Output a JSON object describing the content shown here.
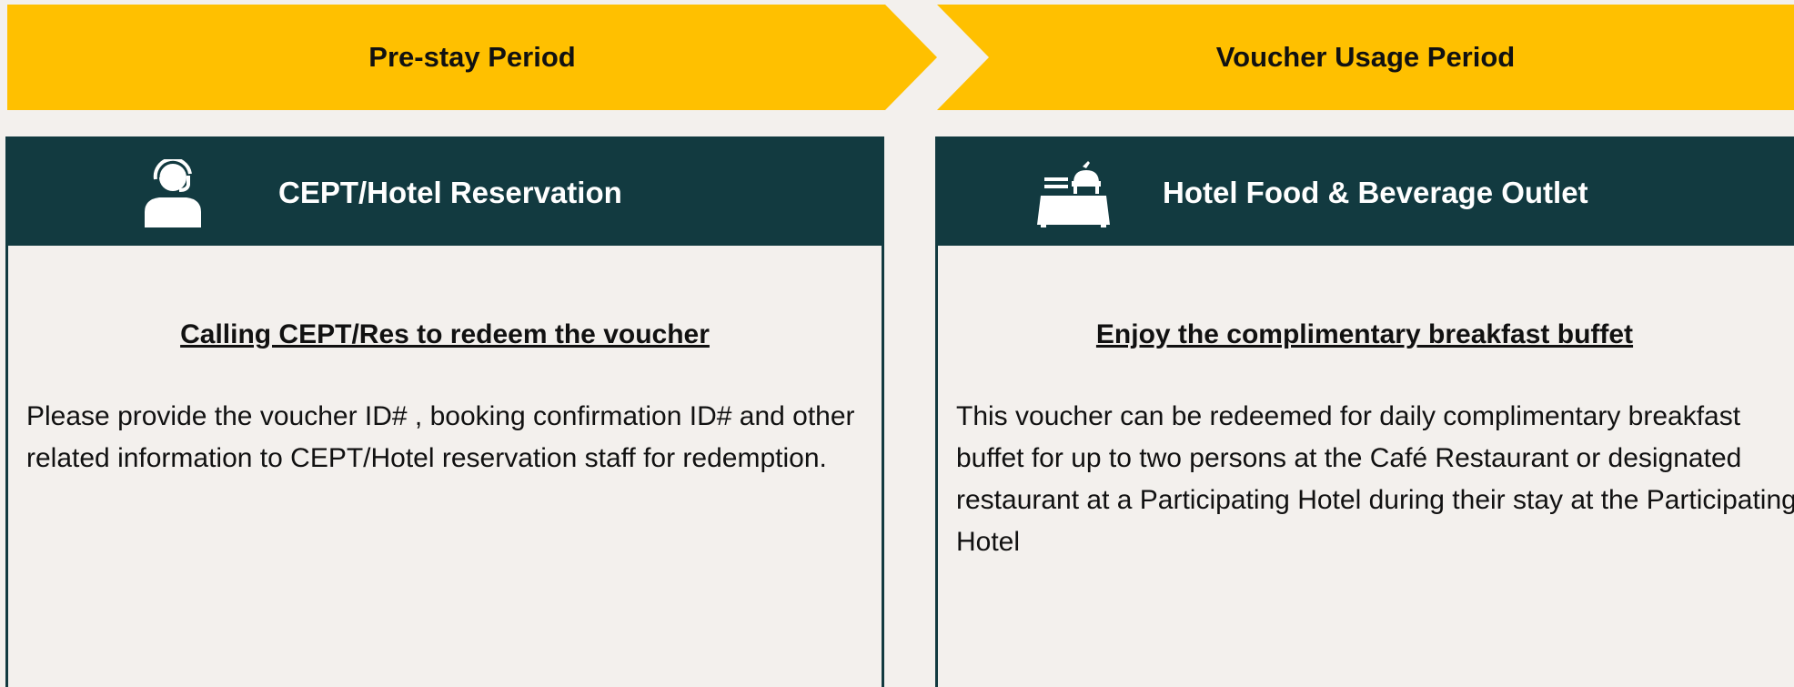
{
  "phases": {
    "left": {
      "label": "Pre-stay Period"
    },
    "right": {
      "label": "Voucher Usage Period"
    }
  },
  "panels": {
    "left": {
      "icon": "headset-agent-icon",
      "title": "CEPT/Hotel Reservation",
      "subtitle": "Calling CEPT/Res to redeem the voucher",
      "body": "Please provide the voucher ID# , booking confirmation ID# and other related information to CEPT/Hotel reservation staff for redemption."
    },
    "right": {
      "icon": "buffet-table-icon",
      "title": "Hotel Food & Beverage Outlet",
      "subtitle": "Enjoy the complimentary breakfast buffet",
      "body": "This voucher can be redeemed for daily complimentary breakfast buffet for up to two persons at the Café Restaurant or designated restaurant at a Participating Hotel during their stay at the Participating Hotel"
    }
  },
  "colors": {
    "arrow": "#ffc000",
    "header": "#123a40",
    "background": "#f3f0ed"
  }
}
